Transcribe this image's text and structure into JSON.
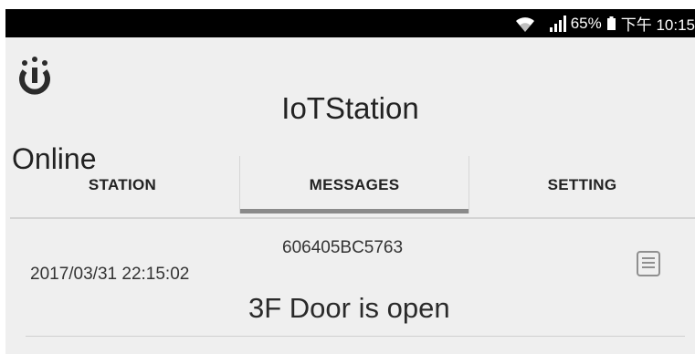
{
  "status_bar": {
    "battery": "65%",
    "time": "下午 10:15",
    "icons": [
      "wifi-icon",
      "signal-icon",
      "battery-icon"
    ]
  },
  "app": {
    "logo_icon": "power-logo-icon",
    "title": "IoTStation",
    "status": "Online"
  },
  "tabs": [
    {
      "label": "STATION",
      "selected": false
    },
    {
      "label": "MESSAGES",
      "selected": true
    },
    {
      "label": "SETTING",
      "selected": false
    }
  ],
  "messages": [
    {
      "device_id": "606405BC5763",
      "timestamp": "2017/03/31 22:15:02",
      "text": "3F Door is open",
      "icon": "message-detail-icon"
    }
  ],
  "colors": {
    "status_bar_bg": "#000000",
    "app_bg": "#efefef",
    "tab_indicator": "#8a8a8a",
    "text": "#222222"
  }
}
